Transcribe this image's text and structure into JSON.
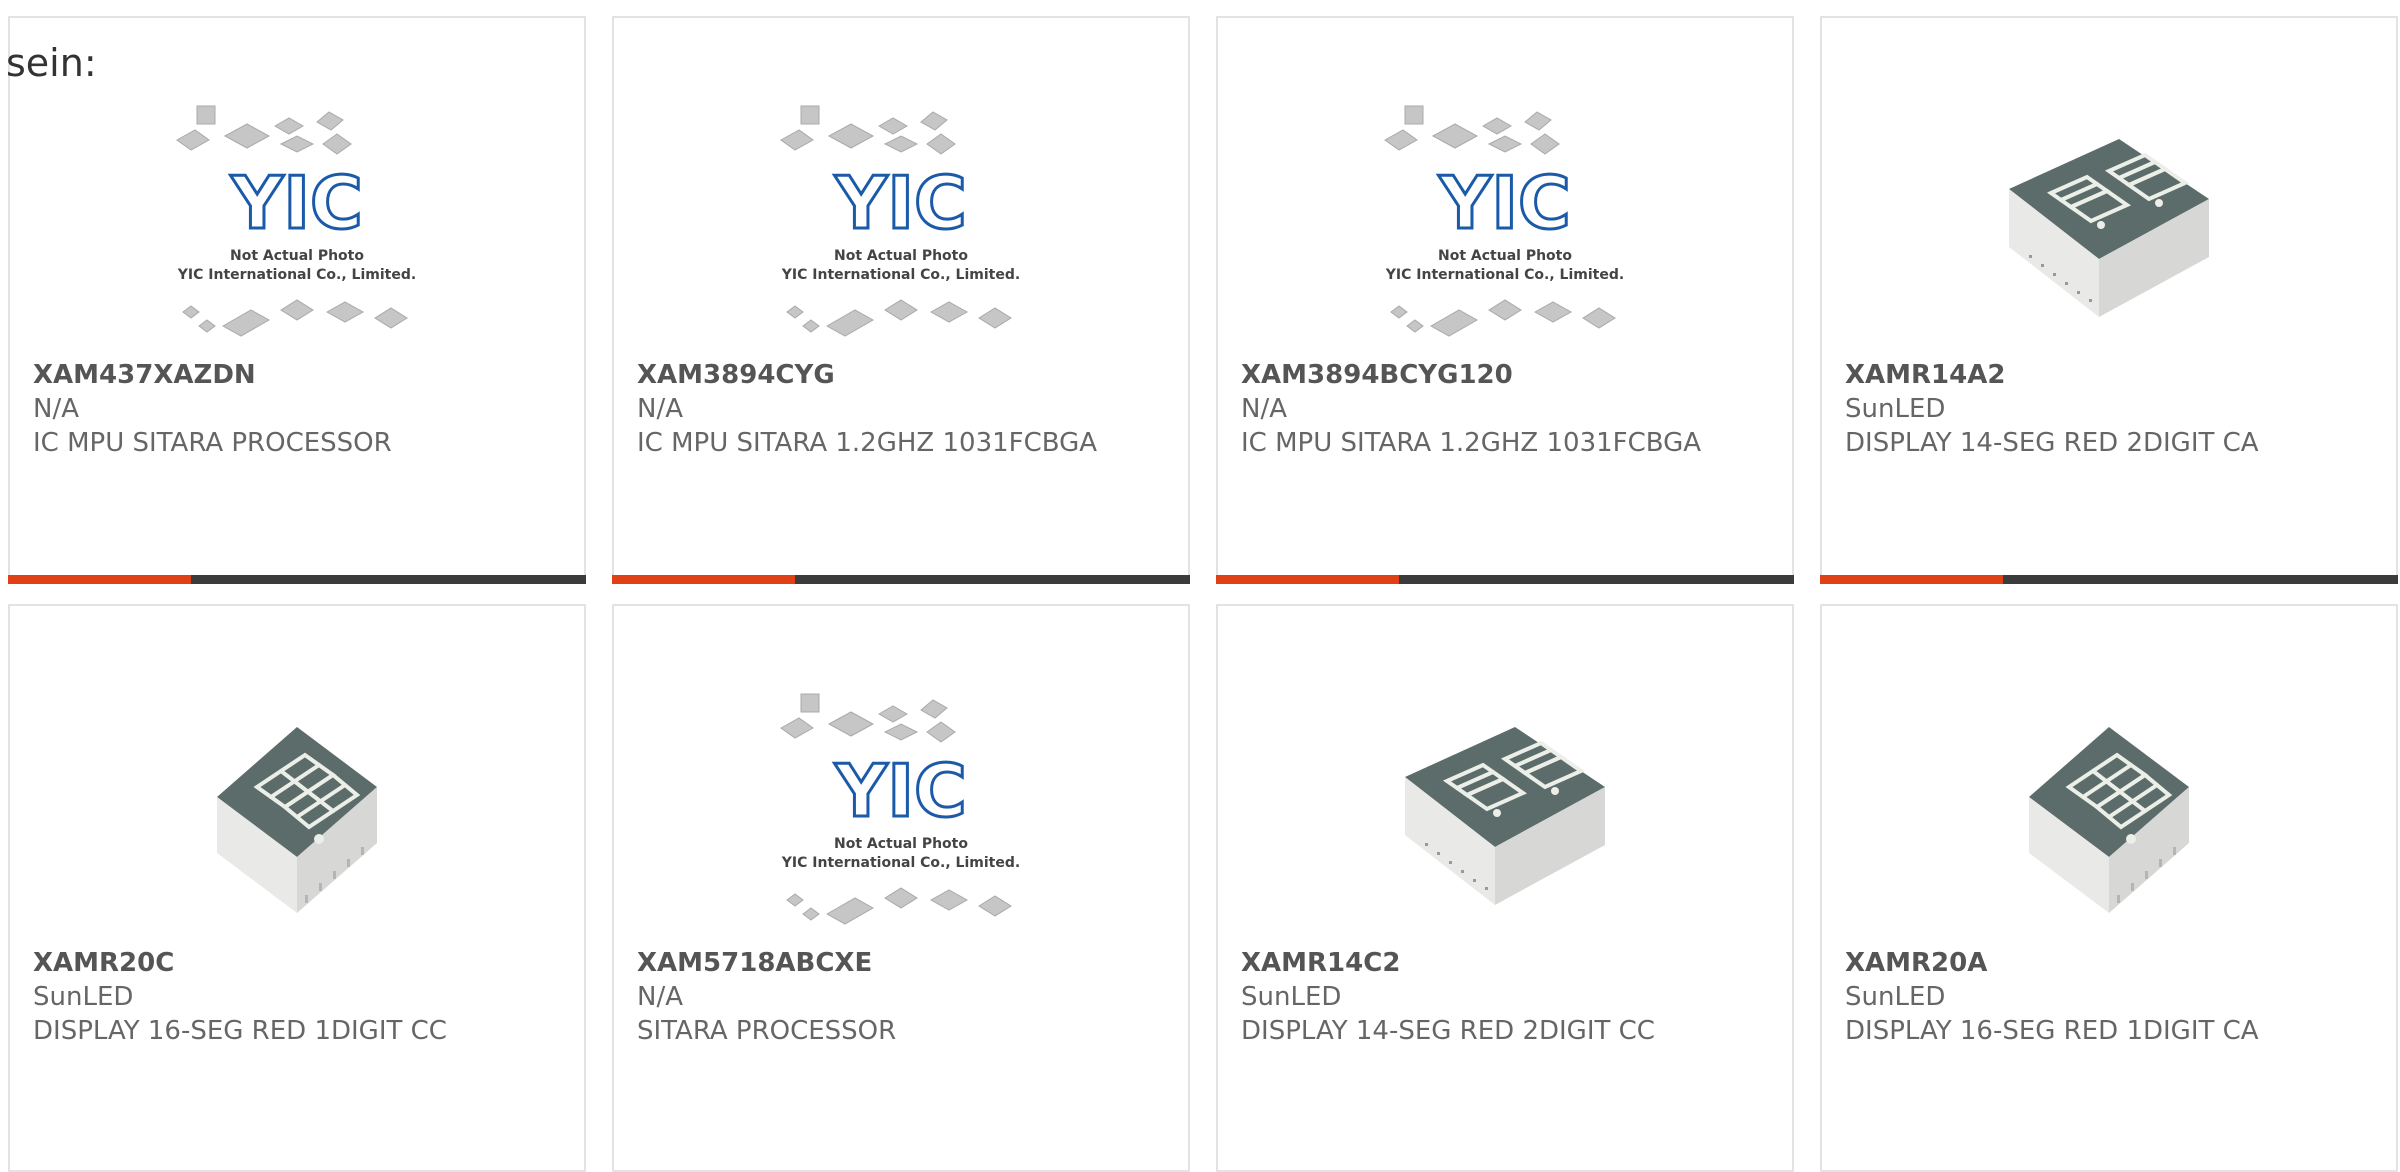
{
  "intro_text": "sein:",
  "colors": {
    "accent": "#e04016",
    "bar": "#3b3b3b",
    "border": "#e3e3e3",
    "text": "#666666"
  },
  "products": [
    {
      "part": "XAM437XAZDN",
      "brand": "N/A",
      "desc": "IC MPU SITARA PROCESSOR",
      "image": "yic-placeholder"
    },
    {
      "part": "XAM3894CYG",
      "brand": "N/A",
      "desc": "IC MPU SITARA 1.2GHZ 1031FCBGA",
      "image": "yic-placeholder"
    },
    {
      "part": "XAM3894BCYG120",
      "brand": "N/A",
      "desc": "IC MPU SITARA 1.2GHZ 1031FCBGA",
      "image": "yic-placeholder"
    },
    {
      "part": "XAMR14A2",
      "brand": "SunLED",
      "desc": "DISPLAY 14-SEG RED 2DIGIT CA",
      "image": "display-2digit"
    },
    {
      "part": "XAMR20C",
      "brand": "SunLED",
      "desc": "DISPLAY 16-SEG RED 1DIGIT CC",
      "image": "display-1digit"
    },
    {
      "part": "XAM5718ABCXE",
      "brand": "N/A",
      "desc": "SITARA PROCESSOR",
      "image": "yic-placeholder"
    },
    {
      "part": "XAMR14C2",
      "brand": "SunLED",
      "desc": "DISPLAY 14-SEG RED 2DIGIT CC",
      "image": "display-2digit"
    },
    {
      "part": "XAMR20A",
      "brand": "SunLED",
      "desc": "DISPLAY 16-SEG RED 1DIGIT CA",
      "image": "display-1digit"
    }
  ],
  "yic_image": {
    "logo": "YIC",
    "line1": "Not Actual Photo",
    "line2": "YIC International Co., Limited."
  }
}
